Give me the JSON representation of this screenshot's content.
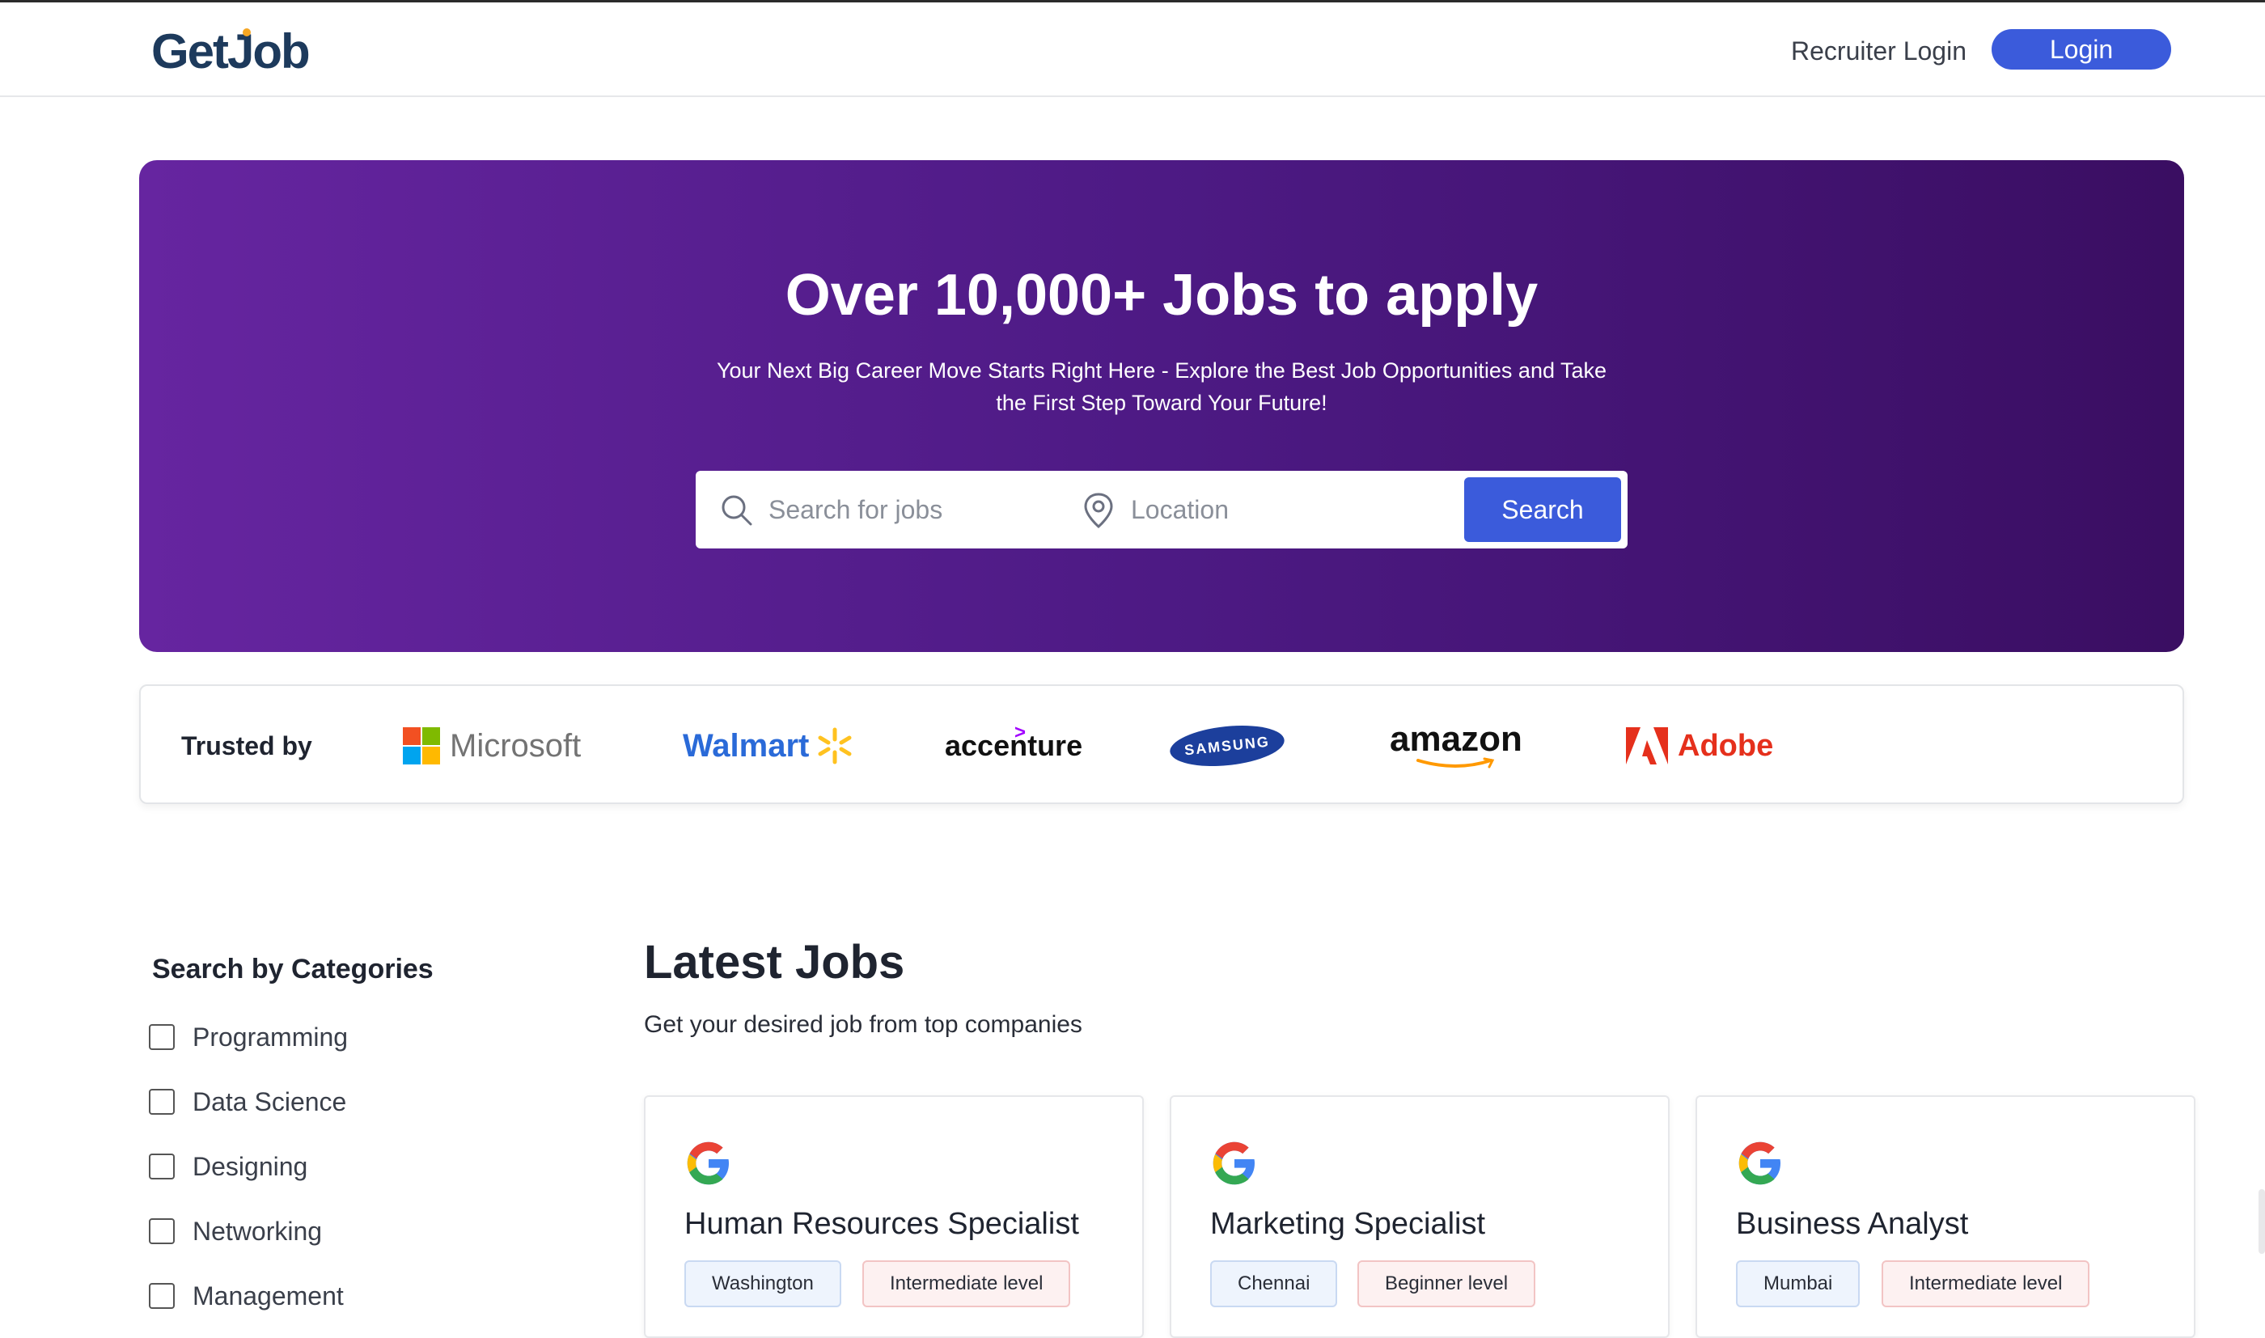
{
  "header": {
    "logo_text_a": "Ge",
    "logo_text_b": "t",
    "logo_text_c": "Job",
    "recruiter_login": "Recruiter Login",
    "login": "Login"
  },
  "hero": {
    "title": "Over 10,000+ Jobs to apply",
    "subtitle": "Your Next Big Career Move Starts Right Here - Explore the Best Job Opportunities and Take the First Step Toward Your Future!",
    "search_placeholder": "Search for jobs",
    "location_placeholder": "Location",
    "search_button": "Search"
  },
  "trusted": {
    "label": "Trusted by",
    "brands": [
      "Microsoft",
      "Walmart",
      "accenture",
      "SAMSUNG",
      "amazon",
      "Adobe"
    ]
  },
  "categories": {
    "title": "Search by Categories",
    "items": [
      "Programming",
      "Data Science",
      "Designing",
      "Networking",
      "Management"
    ]
  },
  "latest": {
    "title": "Latest Jobs",
    "subtitle": "Get your desired job from top companies",
    "jobs": [
      {
        "title": "Human Resources Specialist",
        "location": "Washington",
        "level": "Intermediate level"
      },
      {
        "title": "Marketing Specialist",
        "location": "Chennai",
        "level": "Beginner level"
      },
      {
        "title": "Business Analyst",
        "location": "Mumbai",
        "level": "Intermediate level"
      }
    ]
  },
  "colors": {
    "accent": "#3b5bdb",
    "hero_start": "#6625a0",
    "hero_end": "#3a0e62"
  }
}
